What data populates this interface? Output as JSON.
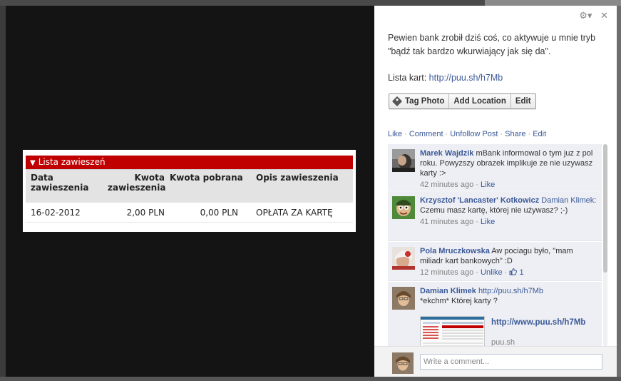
{
  "photo": {
    "header": "Lista zawieszeń",
    "columns": [
      "Data zawieszenia",
      "Kwota zawieszenia",
      "Kwota pobrana",
      "Opis zawieszenia"
    ],
    "row": [
      "16-02-2012",
      "2,00 PLN",
      "0,00 PLN",
      "OPŁATA ZA KARTĘ"
    ]
  },
  "panel": {
    "settings_glyph": "⚙▾",
    "close_glyph": "✕",
    "caption_line1": "Pewien bank zrobił dziś coś, co aktywuje u mnie tryb \"bądź tak bardzo wkurwiający jak się da\".",
    "caption_prefix": "Lista kart: ",
    "caption_link": "http://puu.sh/h7Mb",
    "buttons": {
      "tag": "Tag Photo",
      "location": "Add Location",
      "edit": "Edit"
    },
    "story_actions": [
      "Like",
      "Comment",
      "Unfollow Post",
      "Share",
      "Edit"
    ],
    "separator": "·"
  },
  "comments": [
    {
      "author": "Marek Wajdzik",
      "text": "mBank informowal o tym juz z pol roku. Powyzszy obrazek implikuje ze nie uzywasz karty :>",
      "time": "42 minutes ago",
      "action": "Like"
    },
    {
      "author": "Krzysztof 'Lancaster' Kotkowicz",
      "mention": "Damian Klimek",
      "text": ": Czemu masz kartę, której nie używasz? ;-)",
      "time": "41 minutes ago",
      "action": "Like"
    },
    {
      "author": "Pola Mruczkowska",
      "text": "Aw pociagu było, \"mam miliadr kart bankowych\" :D",
      "time": "12 minutes ago",
      "action": "Unlike",
      "likes": "1"
    },
    {
      "author": "Damian Klimek",
      "link": "http://puu.sh/h7Mb",
      "text": "*ekchm* Której karty ?",
      "preview_title": "http://www.puu.sh/h7Mb",
      "preview_domain": "puu.sh"
    }
  ],
  "comment_input": {
    "placeholder": "Write a comment..."
  },
  "colors": {
    "brand_blue": "#3b5998",
    "header_red": "#c00000",
    "comment_bg": "#edeff4"
  }
}
